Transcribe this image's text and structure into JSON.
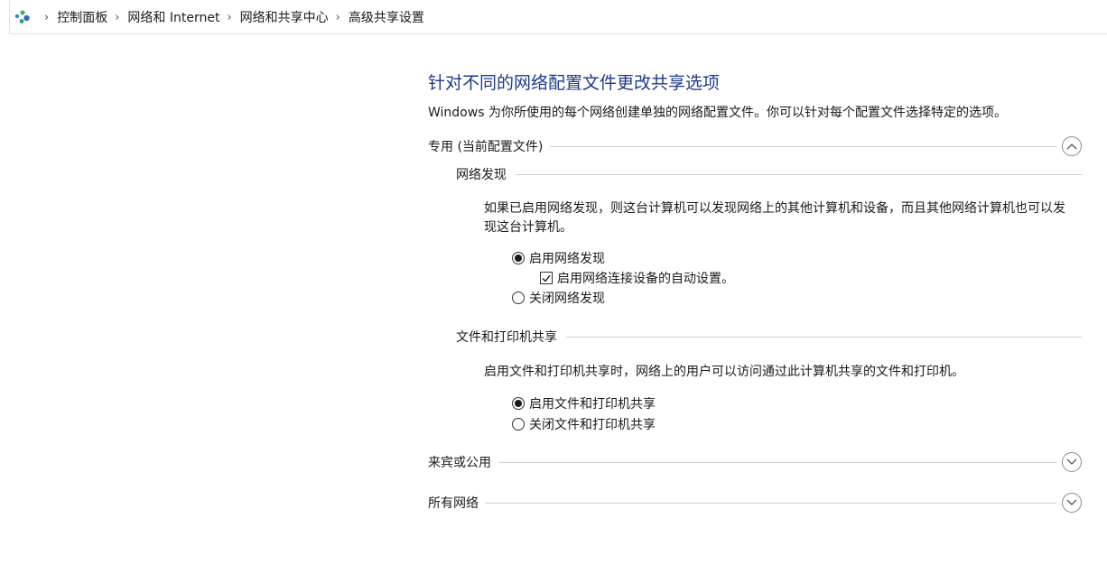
{
  "breadcrumb": {
    "items": [
      "控制面板",
      "网络和 Internet",
      "网络和共享中心",
      "高级共享设置"
    ]
  },
  "page": {
    "title": "针对不同的网络配置文件更改共享选项",
    "description": "Windows 为你所使用的每个网络创建单独的网络配置文件。你可以针对每个配置文件选择特定的选项。"
  },
  "sections": {
    "private": {
      "label": "专用 (当前配置文件)",
      "network_discovery": {
        "label": "网络发现",
        "description": "如果已启用网络发现，则这台计算机可以发现网络上的其他计算机和设备，而且其他网络计算机也可以发现这台计算机。",
        "on_label": "启用网络发现",
        "auto_setup_label": "启用网络连接设备的自动设置。",
        "off_label": "关闭网络发现",
        "selected": "on",
        "auto_setup_checked": true
      },
      "file_printer_sharing": {
        "label": "文件和打印机共享",
        "description": "启用文件和打印机共享时，网络上的用户可以访问通过此计算机共享的文件和打印机。",
        "on_label": "启用文件和打印机共享",
        "off_label": "关闭文件和打印机共享",
        "selected": "on"
      }
    },
    "guest_public": {
      "label": "来宾或公用"
    },
    "all_networks": {
      "label": "所有网络"
    }
  },
  "icons": {
    "control_panel": "control-panel-icon",
    "breadcrumb_separator": "chevron-right-icon",
    "collapse": "chevron-up-icon",
    "expand": "chevron-down-icon"
  },
  "colors": {
    "title": "#1e3a8a",
    "divider": "#cfcfcf"
  }
}
